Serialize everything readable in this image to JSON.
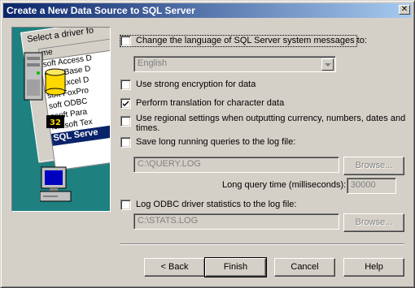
{
  "window": {
    "title": "Create a New Data Source to SQL Server",
    "close_glyph": "✕"
  },
  "illustration": {
    "dialog_header": "Select a driver fo",
    "column_header": "me",
    "list_items": [
      "soft Access D",
      "soft dBase D",
      "soft Excel D",
      "soft FoxPro",
      "soft ODBC",
      "osoft Para",
      "icrosoft Tex"
    ],
    "selected_item": "SQL Serve",
    "badge_text": "32"
  },
  "options": {
    "change_language": {
      "label": "Change the language of SQL Server system messages to:",
      "checked": false
    },
    "language_select": {
      "value": "English"
    },
    "strong_encryption": {
      "label": "Use strong encryption for data",
      "checked": false
    },
    "translation": {
      "label": "Perform translation for character data",
      "checked": true
    },
    "regional": {
      "label_line1": "Use regional settings when outputting currency, numbers, dates and",
      "label_line2": "times.",
      "checked": false
    },
    "save_long_queries": {
      "label": "Save long running queries to the log file:",
      "checked": false
    },
    "query_log_path": "C:\\QUERY.LOG",
    "query_browse": "Browse...",
    "long_query_time_label": "Long query time (milliseconds):",
    "long_query_time_value": "30000",
    "log_stats": {
      "label": "Log ODBC driver statistics to the log file:",
      "checked": false
    },
    "stats_log_path": "C:\\STATS.LOG",
    "stats_browse": "Browse..."
  },
  "buttons": {
    "back": "< Back",
    "finish": "Finish",
    "cancel": "Cancel",
    "help": "Help"
  }
}
